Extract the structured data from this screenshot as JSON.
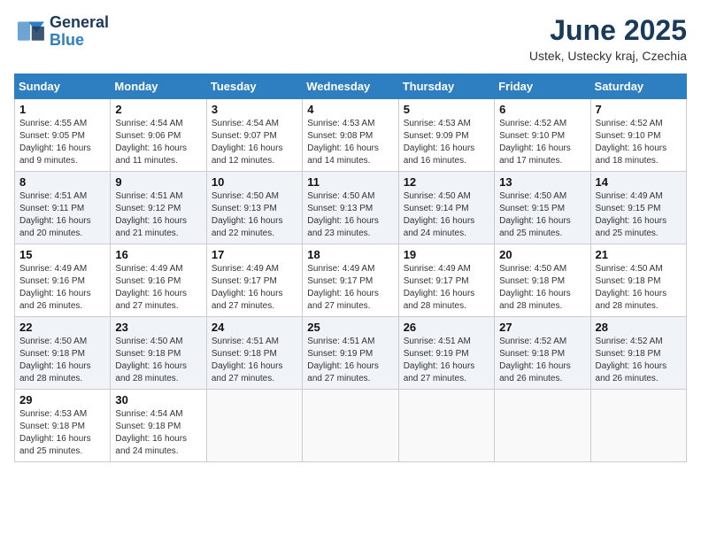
{
  "header": {
    "logo_line1": "General",
    "logo_line2": "Blue",
    "month_title": "June 2025",
    "location": "Ustek, Ustecky kraj, Czechia"
  },
  "weekdays": [
    "Sunday",
    "Monday",
    "Tuesday",
    "Wednesday",
    "Thursday",
    "Friday",
    "Saturday"
  ],
  "weeks": [
    [
      {
        "day": "1",
        "sunrise": "4:55 AM",
        "sunset": "9:05 PM",
        "daylight": "16 hours and 9 minutes."
      },
      {
        "day": "2",
        "sunrise": "4:54 AM",
        "sunset": "9:06 PM",
        "daylight": "16 hours and 11 minutes."
      },
      {
        "day": "3",
        "sunrise": "4:54 AM",
        "sunset": "9:07 PM",
        "daylight": "16 hours and 12 minutes."
      },
      {
        "day": "4",
        "sunrise": "4:53 AM",
        "sunset": "9:08 PM",
        "daylight": "16 hours and 14 minutes."
      },
      {
        "day": "5",
        "sunrise": "4:53 AM",
        "sunset": "9:09 PM",
        "daylight": "16 hours and 16 minutes."
      },
      {
        "day": "6",
        "sunrise": "4:52 AM",
        "sunset": "9:10 PM",
        "daylight": "16 hours and 17 minutes."
      },
      {
        "day": "7",
        "sunrise": "4:52 AM",
        "sunset": "9:10 PM",
        "daylight": "16 hours and 18 minutes."
      }
    ],
    [
      {
        "day": "8",
        "sunrise": "4:51 AM",
        "sunset": "9:11 PM",
        "daylight": "16 hours and 20 minutes."
      },
      {
        "day": "9",
        "sunrise": "4:51 AM",
        "sunset": "9:12 PM",
        "daylight": "16 hours and 21 minutes."
      },
      {
        "day": "10",
        "sunrise": "4:50 AM",
        "sunset": "9:13 PM",
        "daylight": "16 hours and 22 minutes."
      },
      {
        "day": "11",
        "sunrise": "4:50 AM",
        "sunset": "9:13 PM",
        "daylight": "16 hours and 23 minutes."
      },
      {
        "day": "12",
        "sunrise": "4:50 AM",
        "sunset": "9:14 PM",
        "daylight": "16 hours and 24 minutes."
      },
      {
        "day": "13",
        "sunrise": "4:50 AM",
        "sunset": "9:15 PM",
        "daylight": "16 hours and 25 minutes."
      },
      {
        "day": "14",
        "sunrise": "4:49 AM",
        "sunset": "9:15 PM",
        "daylight": "16 hours and 25 minutes."
      }
    ],
    [
      {
        "day": "15",
        "sunrise": "4:49 AM",
        "sunset": "9:16 PM",
        "daylight": "16 hours and 26 minutes."
      },
      {
        "day": "16",
        "sunrise": "4:49 AM",
        "sunset": "9:16 PM",
        "daylight": "16 hours and 27 minutes."
      },
      {
        "day": "17",
        "sunrise": "4:49 AM",
        "sunset": "9:17 PM",
        "daylight": "16 hours and 27 minutes."
      },
      {
        "day": "18",
        "sunrise": "4:49 AM",
        "sunset": "9:17 PM",
        "daylight": "16 hours and 27 minutes."
      },
      {
        "day": "19",
        "sunrise": "4:49 AM",
        "sunset": "9:17 PM",
        "daylight": "16 hours and 28 minutes."
      },
      {
        "day": "20",
        "sunrise": "4:50 AM",
        "sunset": "9:18 PM",
        "daylight": "16 hours and 28 minutes."
      },
      {
        "day": "21",
        "sunrise": "4:50 AM",
        "sunset": "9:18 PM",
        "daylight": "16 hours and 28 minutes."
      }
    ],
    [
      {
        "day": "22",
        "sunrise": "4:50 AM",
        "sunset": "9:18 PM",
        "daylight": "16 hours and 28 minutes."
      },
      {
        "day": "23",
        "sunrise": "4:50 AM",
        "sunset": "9:18 PM",
        "daylight": "16 hours and 28 minutes."
      },
      {
        "day": "24",
        "sunrise": "4:51 AM",
        "sunset": "9:18 PM",
        "daylight": "16 hours and 27 minutes."
      },
      {
        "day": "25",
        "sunrise": "4:51 AM",
        "sunset": "9:19 PM",
        "daylight": "16 hours and 27 minutes."
      },
      {
        "day": "26",
        "sunrise": "4:51 AM",
        "sunset": "9:19 PM",
        "daylight": "16 hours and 27 minutes."
      },
      {
        "day": "27",
        "sunrise": "4:52 AM",
        "sunset": "9:18 PM",
        "daylight": "16 hours and 26 minutes."
      },
      {
        "day": "28",
        "sunrise": "4:52 AM",
        "sunset": "9:18 PM",
        "daylight": "16 hours and 26 minutes."
      }
    ],
    [
      {
        "day": "29",
        "sunrise": "4:53 AM",
        "sunset": "9:18 PM",
        "daylight": "16 hours and 25 minutes."
      },
      {
        "day": "30",
        "sunrise": "4:54 AM",
        "sunset": "9:18 PM",
        "daylight": "16 hours and 24 minutes."
      },
      null,
      null,
      null,
      null,
      null
    ]
  ]
}
